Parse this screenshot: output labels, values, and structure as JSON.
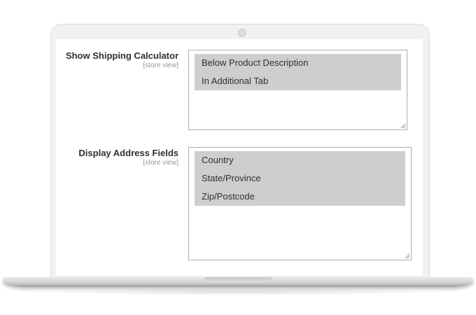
{
  "form": {
    "shipping_calculator": {
      "label": "Show Shipping Calculator",
      "scope": "[store view]",
      "options": [
        {
          "label": "Below Product Description",
          "selected": true
        },
        {
          "label": "In Additional Tab",
          "selected": true
        }
      ]
    },
    "address_fields": {
      "label": "Display Address Fields",
      "scope": "[store view]",
      "options": [
        {
          "label": "Country",
          "selected": true
        },
        {
          "label": "State/Province",
          "selected": true
        },
        {
          "label": "Zip/Postcode",
          "selected": true
        }
      ]
    }
  },
  "colors": {
    "selected_option_bg": "#cecece",
    "label_text": "#303030",
    "scope_text": "#999999",
    "field_border": "#adadad"
  },
  "icons": [
    "camera-icon",
    "resize-grip-icon"
  ]
}
